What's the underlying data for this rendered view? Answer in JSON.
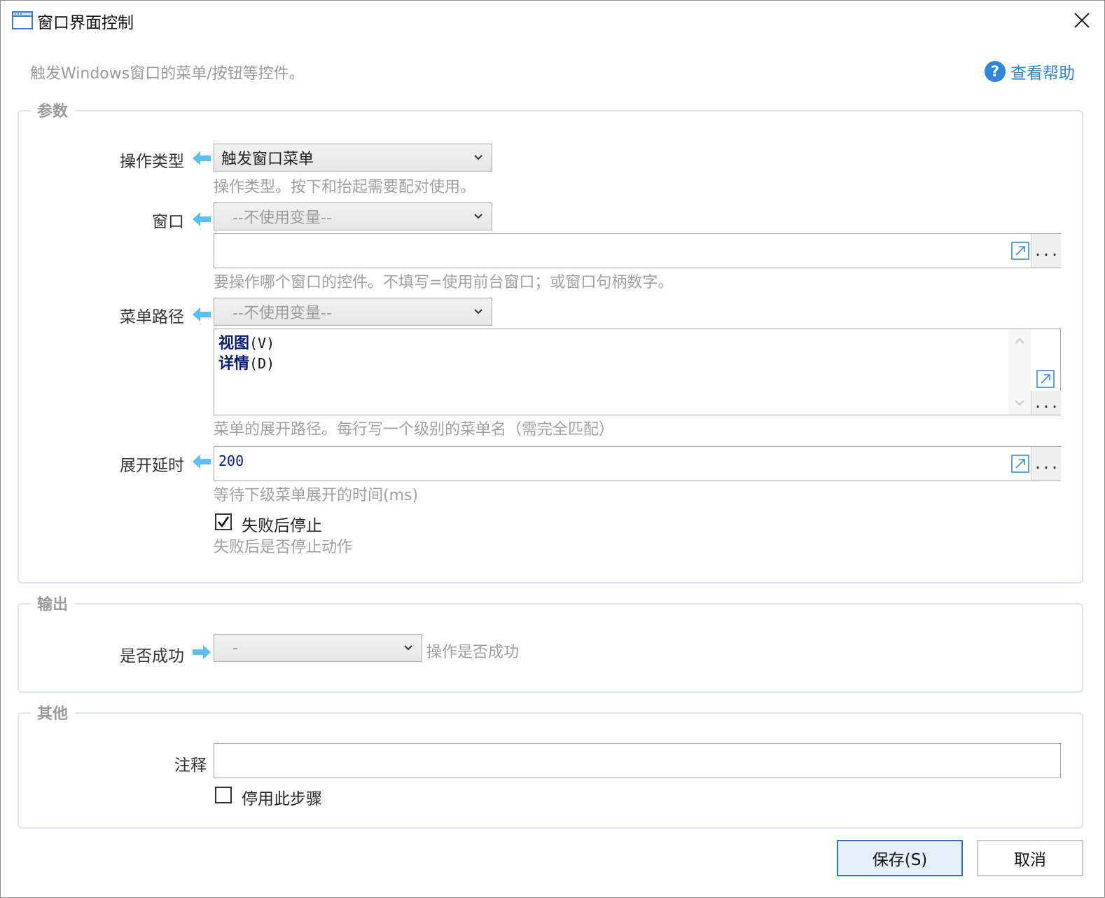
{
  "window": {
    "title": "窗口界面控制",
    "description": "触发Windows窗口的菜单/按钮等控件。",
    "help_label": "查看帮助"
  },
  "params": {
    "group_title": "参数",
    "operation_type": {
      "label": "操作类型",
      "value": "触发窗口菜单",
      "hint": "操作类型。按下和抬起需要配对使用。"
    },
    "window_target": {
      "label": "窗口",
      "variable": "--不使用变量--",
      "value": "",
      "hint": "要操作哪个窗口的控件。不填写=使用前台窗口；或窗口句柄数字。"
    },
    "menu_path": {
      "label": "菜单路径",
      "variable": "--不使用变量--",
      "lines": [
        {
          "name": "视图",
          "accel": "(V)"
        },
        {
          "name": "详情",
          "accel": "(D)"
        }
      ],
      "hint": "菜单的展开路径。每行写一个级别的菜单名（需完全匹配）"
    },
    "expand_delay": {
      "label": "展开延时",
      "value": "200",
      "hint": "等待下级菜单展开的时间(ms)"
    },
    "stop_on_fail": {
      "label": "失败后停止",
      "checked": true,
      "hint": "失败后是否停止动作"
    },
    "dots": "..."
  },
  "output": {
    "group_title": "输出",
    "success": {
      "label": "是否成功",
      "value": "-",
      "hint": "操作是否成功"
    }
  },
  "other": {
    "group_title": "其他",
    "comment": {
      "label": "注释",
      "value": ""
    },
    "disable_step": {
      "label": "停用此步骤",
      "checked": false
    }
  },
  "buttons": {
    "save": "保存(S)",
    "cancel": "取消"
  },
  "colors": {
    "accent": "#2f87d8",
    "arrow": "#5bc0f0",
    "border": "#dde6ef",
    "primary_border": "#2c6fd6"
  }
}
